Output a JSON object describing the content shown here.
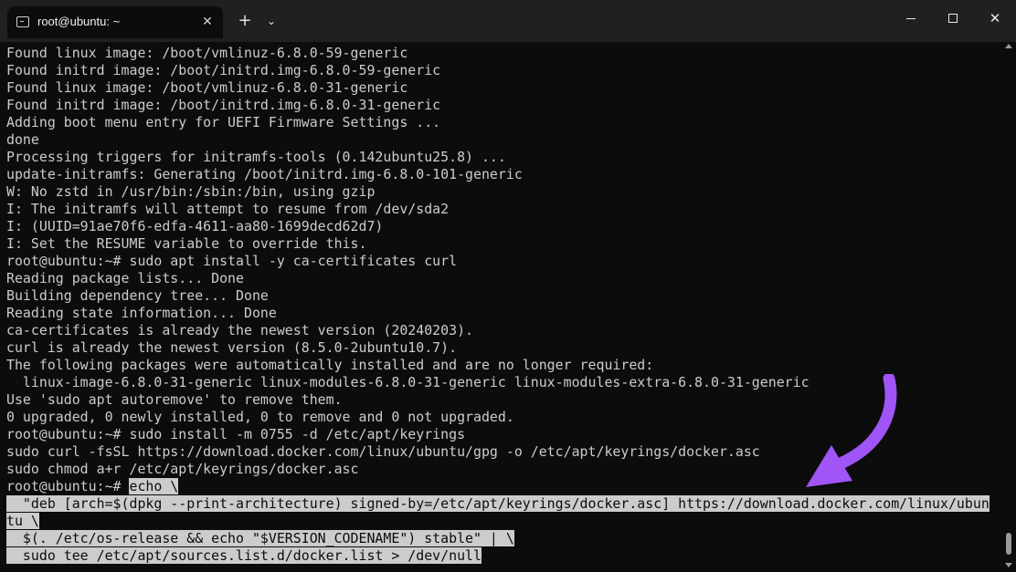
{
  "window": {
    "tab_title": "root@ubuntu: ~",
    "tab_close_glyph": "✕",
    "new_tab_glyph": "+",
    "dropdown_glyph": "⌄",
    "close_glyph": "✕"
  },
  "terminal": {
    "lines": [
      "Found linux image: /boot/vmlinuz-6.8.0-59-generic",
      "Found initrd image: /boot/initrd.img-6.8.0-59-generic",
      "Found linux image: /boot/vmlinuz-6.8.0-31-generic",
      "Found initrd image: /boot/initrd.img-6.8.0-31-generic",
      "Adding boot menu entry for UEFI Firmware Settings ...",
      "done",
      "Processing triggers for initramfs-tools (0.142ubuntu25.8) ...",
      "update-initramfs: Generating /boot/initrd.img-6.8.0-101-generic",
      "W: No zstd in /usr/bin:/sbin:/bin, using gzip",
      "I: The initramfs will attempt to resume from /dev/sda2",
      "I: (UUID=91ae70f6-edfa-4611-aa80-1699decd62d7)",
      "I: Set the RESUME variable to override this.",
      "root@ubuntu:~# sudo apt install -y ca-certificates curl",
      "Reading package lists... Done",
      "Building dependency tree... Done",
      "Reading state information... Done",
      "ca-certificates is already the newest version (20240203).",
      "curl is already the newest version (8.5.0-2ubuntu10.7).",
      "The following packages were automatically installed and are no longer required:",
      "  linux-image-6.8.0-31-generic linux-modules-6.8.0-31-generic linux-modules-extra-6.8.0-31-generic",
      "Use 'sudo apt autoremove' to remove them.",
      "0 upgraded, 0 newly installed, 0 to remove and 0 not upgraded.",
      "root@ubuntu:~# sudo install -m 0755 -d /etc/apt/keyrings",
      "sudo curl -fsSL https://download.docker.com/linux/ubuntu/gpg -o /etc/apt/keyrings/docker.asc",
      "sudo chmod a+r /etc/apt/keyrings/docker.asc"
    ],
    "prompt": "root@ubuntu:~# ",
    "highlighted_command": [
      "echo \\",
      "  \"deb [arch=$(dpkg --print-architecture) signed-by=/etc/apt/keyrings/docker.asc] https://download.docker.com/linux/ubun",
      "tu \\",
      "  $(. /etc/os-release && echo \"$VERSION_CODENAME\") stable\" | \\",
      "  sudo tee /etc/apt/sources.list.d/docker.list > /dev/null"
    ]
  },
  "icons": {
    "terminal": "terminal-icon",
    "annotation": "purple-arrow-icon"
  },
  "colors": {
    "background": "#0c0c0c",
    "text": "#cccccc",
    "selection": "#cccccc",
    "titlebar": "#202020",
    "arrow": "#a055f7"
  }
}
